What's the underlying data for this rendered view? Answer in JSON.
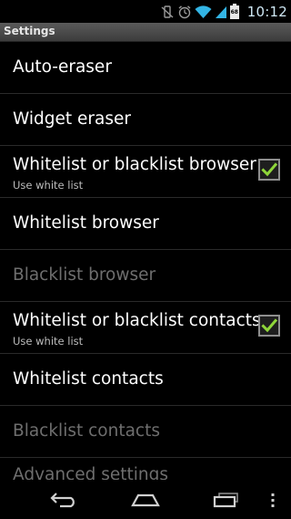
{
  "status_bar": {
    "time": "10:12",
    "icons": [
      "vibrate-mute-icon",
      "alarm-icon",
      "wifi-icon",
      "signal-icon",
      "battery-icon"
    ],
    "battery_text": "68"
  },
  "title_bar": {
    "title": "Settings"
  },
  "settings": {
    "items": [
      {
        "label": "Auto-eraser",
        "enabled": true
      },
      {
        "label": "Widget eraser",
        "enabled": true
      },
      {
        "label": "Whitelist or blacklist browser",
        "summary": "Use white list",
        "checked": true,
        "enabled": true
      },
      {
        "label": "Whitelist browser",
        "enabled": true
      },
      {
        "label": "Blacklist browser",
        "enabled": false
      },
      {
        "label": "Whitelist or blacklist contacts",
        "summary": "Use white list",
        "checked": true,
        "enabled": true
      },
      {
        "label": "Whitelist contacts",
        "enabled": true
      },
      {
        "label": "Blacklist contacts",
        "enabled": false
      },
      {
        "label": "Advanced settings",
        "enabled": true
      }
    ]
  },
  "nav_bar": {
    "buttons": [
      "back-icon",
      "home-icon",
      "recent-apps-icon",
      "overflow-menu-icon"
    ]
  },
  "colors": {
    "check": "#8fd63a",
    "disabled_text": "#6e6e6e",
    "clock": "#cfe8f5",
    "status_icons": "#33b5e5"
  }
}
